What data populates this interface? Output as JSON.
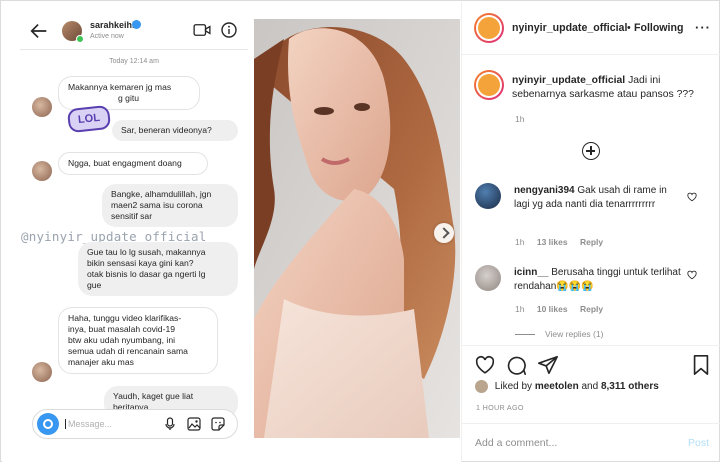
{
  "colors": {
    "accent": "#3897f0",
    "text": "#262626",
    "muted": "#8e8e8e",
    "border": "#dbdbdb",
    "post_disabled": "#b2dffc"
  },
  "chat": {
    "username": "sarahkeihl",
    "status": "Active now",
    "timestamp": "Today 12:14 am",
    "sticker": "LOL",
    "watermark": "@nyinyir_update_official",
    "composer_placeholder": "Message...",
    "messages": [
      {
        "dir": "in",
        "lines": [
          "Makannya kemaren jg mas",
          "g gitu"
        ]
      },
      {
        "dir": "out",
        "lines": [
          "Sar, beneran videonya?"
        ]
      },
      {
        "dir": "in",
        "lines": [
          "Ngga, buat engagment doang"
        ]
      },
      {
        "dir": "out",
        "lines": [
          "Bangke, alhamdulillah, jgn",
          "maen2 sama isu corona",
          "sensitif sar"
        ]
      },
      {
        "dir": "out",
        "lines": [
          "Gue tau lo lg susah, makannya",
          "bikin sensasi kaya gini kan?",
          "otak bisnis lo dasar ga ngerti lg",
          "gue"
        ]
      },
      {
        "dir": "in",
        "lines": [
          "Haha, tunggu video klarifikas-",
          "inya, buat masalah covid-19",
          "btw aku udah nyumbang, ini",
          "semua udah di rencanain sama",
          "manajer aku mas"
        ]
      },
      {
        "dir": "out",
        "lines": [
          "Yaudh, kaget gue liat beritanya."
        ]
      }
    ],
    "icons": [
      "back-arrow-icon",
      "video-call-icon",
      "info-icon",
      "camera-icon",
      "microphone-icon",
      "gallery-icon",
      "sticker-icon"
    ]
  },
  "post": {
    "author": "nyinyir_update_official",
    "separator": "•",
    "follow_label": "Following",
    "more_label": "···",
    "caption": "Jadi ini sebenarnya sarkasme atau pansos ???",
    "caption_time": "1h",
    "comments": [
      {
        "user": "nengyani394",
        "text": "Gak usah di rame in lagi yg ada nanti dia tenarrrrrrrrr",
        "time": "1h",
        "likes": "13 likes",
        "reply": "Reply"
      },
      {
        "user": "icinn__",
        "text": "Berusaha tinggi untuk terlihat rendahan😭😭😭",
        "time": "1h",
        "likes": "10 likes",
        "reply": "Reply"
      }
    ],
    "view_replies": "View replies (1)",
    "liked_by_prefix": "Liked by",
    "liked_by_user": "meetolen",
    "liked_by_and": "and",
    "liked_by_others": "8,311 others",
    "posted_ago": "1 HOUR AGO",
    "add_comment_placeholder": "Add a comment...",
    "post_label": "Post"
  }
}
